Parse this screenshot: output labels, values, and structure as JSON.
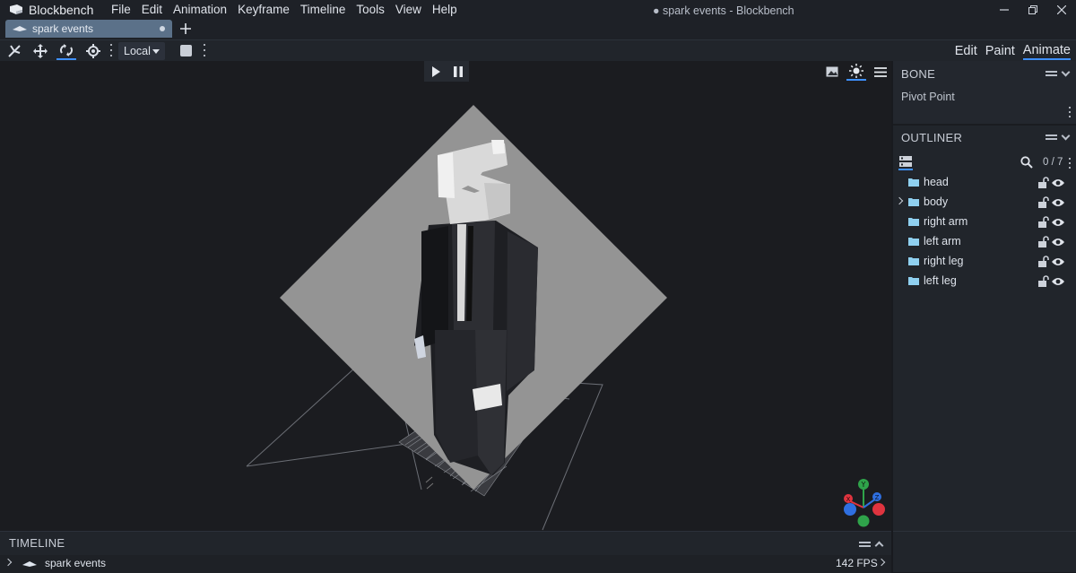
{
  "app": {
    "name": "Blockbench",
    "window_title": "● spark events - Blockbench",
    "menu": [
      "File",
      "Edit",
      "Animation",
      "Keyframe",
      "Timeline",
      "Tools",
      "View",
      "Help"
    ]
  },
  "tabs": [
    {
      "label": "spark events",
      "unsaved": true
    }
  ],
  "toolbar": {
    "space_select": "Local",
    "modes": [
      "Edit",
      "Paint",
      "Animate"
    ],
    "active_mode": "Animate"
  },
  "bone_panel": {
    "title": "BONE",
    "pivot_label": "Pivot Point"
  },
  "outliner": {
    "title": "OUTLINER",
    "count": "0 / 7",
    "items": [
      {
        "label": "head",
        "expandable": false
      },
      {
        "label": "body",
        "expandable": true
      },
      {
        "label": "right arm",
        "expandable": false
      },
      {
        "label": "left arm",
        "expandable": false
      },
      {
        "label": "right leg",
        "expandable": false
      },
      {
        "label": "left leg",
        "expandable": false
      }
    ]
  },
  "timeline": {
    "title": "TIMELINE",
    "animation_name": "spark events",
    "fps": "142 FPS"
  },
  "gizmo": {
    "x_label": "X",
    "y_label": "Y",
    "z_label": "Z",
    "x_color": "#e0343f",
    "y_color": "#2fa34a",
    "z_color": "#2f6fe0"
  },
  "colors": {
    "accent": "#3e90ff",
    "tab_active": "#5b7189",
    "folder": "#8fd0f0"
  }
}
